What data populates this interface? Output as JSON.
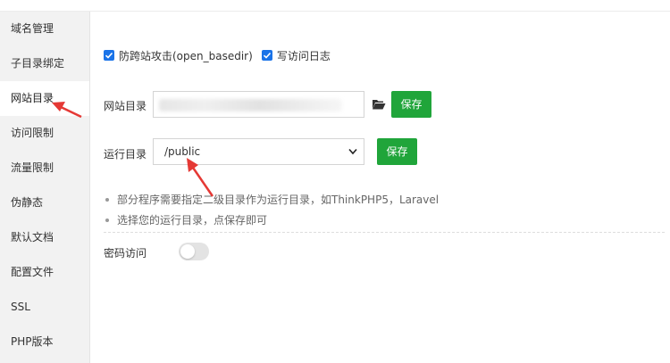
{
  "colors": {
    "accent_green": "#20a53a",
    "checkbox_blue": "#1a73e8",
    "annotation_red": "#e53935",
    "sidebar_bg": "#f2f2f2"
  },
  "sidebar": {
    "items": [
      {
        "label": "域名管理",
        "active": false
      },
      {
        "label": "子目录绑定",
        "active": false
      },
      {
        "label": "网站目录",
        "active": true
      },
      {
        "label": "访问限制",
        "active": false
      },
      {
        "label": "流量限制",
        "active": false
      },
      {
        "label": "伪静态",
        "active": false
      },
      {
        "label": "默认文档",
        "active": false
      },
      {
        "label": "配置文件",
        "active": false
      },
      {
        "label": "SSL",
        "active": false
      },
      {
        "label": "PHP版本",
        "active": false
      }
    ]
  },
  "options": {
    "anti_xss": {
      "label": "防跨站攻击(open_basedir)",
      "checked": true
    },
    "access_log": {
      "label": "写访问日志",
      "checked": true
    }
  },
  "site_dir": {
    "label": "网站目录",
    "value": "",
    "folder_icon": "folder-open-icon",
    "save_label": "保存"
  },
  "run_dir": {
    "label": "运行目录",
    "selected": "/public",
    "save_label": "保存"
  },
  "tips": [
    "部分程序需要指定二级目录作为运行目录，如ThinkPHP5，Laravel",
    "选择您的运行目录，点保存即可"
  ],
  "password_access": {
    "label": "密码访问",
    "enabled": false
  }
}
